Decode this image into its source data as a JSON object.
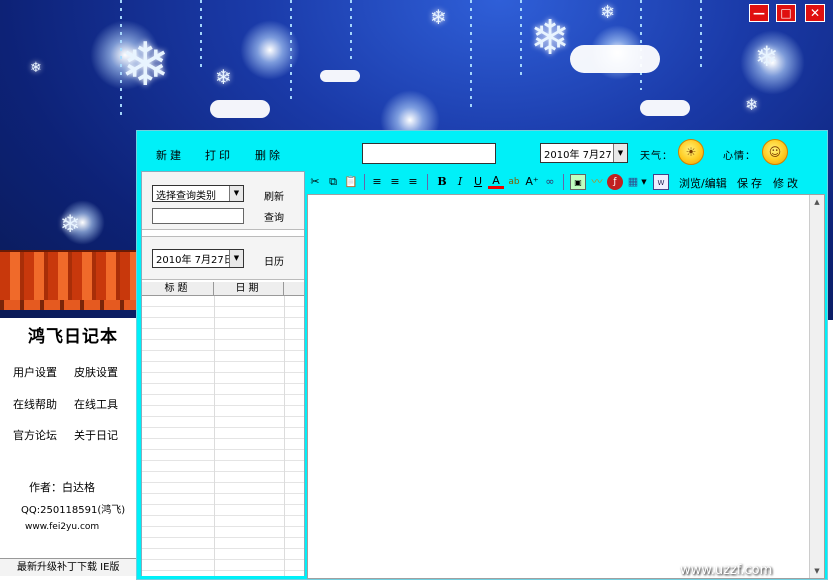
{
  "window": {
    "minimize_label": "—",
    "maximize_label": "□",
    "close_label": "✕"
  },
  "left_panel": {
    "app_title": "鸿飞日记本",
    "links": [
      "用户设置",
      "皮肤设置",
      "在线帮助",
      "在线工具",
      "官方论坛",
      "关于日记"
    ],
    "author": "作者：白达格",
    "qq": "QQ:250118591(鸿飞)",
    "website": "www.fei2yu.com",
    "bottom_text": "最新升级补丁下载    IE版"
  },
  "topbar": {
    "new_label": "新建",
    "print_label": "打印",
    "delete_label": "删除",
    "title_value": "",
    "date_value": "2010年 7月27日",
    "weather_label": "天气：",
    "mood_label": "心情："
  },
  "side": {
    "category_select": "选择查询类别",
    "refresh_label": "刷新",
    "query_input": "",
    "query_label": "查询",
    "calendar_date": "2010年 7月27日",
    "calendar_label": "日历",
    "col_title": "标题",
    "col_date": "日期"
  },
  "toolbar": {
    "icons": [
      "cut-icon",
      "copy-icon",
      "paste-icon",
      "align-left-icon",
      "align-center-icon",
      "align-right-icon",
      "bold-icon",
      "italic-icon",
      "underline-icon",
      "font-color-icon",
      "highlight-icon",
      "font-size-icon",
      "link-icon",
      "image-icon",
      "wave-icon",
      "flash-icon",
      "table-icon",
      "word-icon"
    ],
    "browse_edit_label": "浏览/编辑",
    "save_label": "保存",
    "modify_label": "修改"
  },
  "watermark": "www.uzzf.com",
  "colors": {
    "accent": "#00f0f8",
    "banner": "#1a3aa8",
    "close_red": "#e01010",
    "roof": "#e55a20"
  }
}
